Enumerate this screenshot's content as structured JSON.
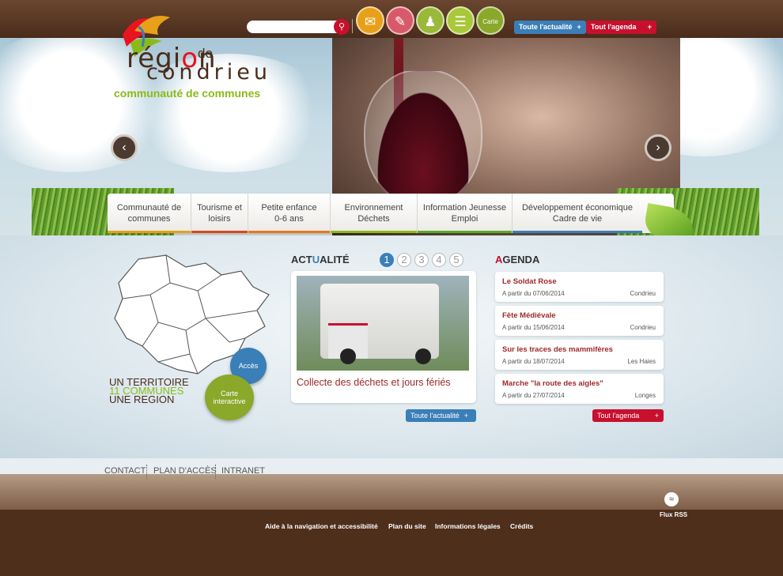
{
  "header": {
    "logo": {
      "line1_a": "régi",
      "line1_o": "o",
      "line1_b": "n",
      "line_de": "de",
      "line2": "condrieu",
      "line3": "communauté de communes"
    },
    "search": {
      "placeholder": ""
    },
    "quick_icons": [
      {
        "name": "envelope-icon",
        "color": "#e8a01a"
      },
      {
        "name": "newsletter-icon",
        "color": "#d85a6a"
      },
      {
        "name": "people-icon",
        "color": "#9ab83a"
      },
      {
        "name": "document-icon",
        "color": "#a8c83a"
      },
      {
        "name": "map-icon",
        "label": "Carte",
        "color": "#8aa82a"
      }
    ],
    "buttons": {
      "news": "Toute l'actualité",
      "agenda": "Tout l'agenda",
      "plus": "+"
    }
  },
  "carousel": {
    "prev": "‹",
    "next": "›"
  },
  "menu": [
    {
      "line1": "Communauté de",
      "line2": "communes",
      "color": "#e8a01a"
    },
    {
      "line1": "Tourisme et",
      "line2": "loisirs",
      "color": "#d8481a"
    },
    {
      "line1": "Petite enfance",
      "line2": "0-6 ans",
      "color": "#e8781a"
    },
    {
      "line1": "Environnement",
      "line2": "Déchets",
      "color": "#8aba1a"
    },
    {
      "line1": "Information Jeunesse",
      "line2": "Emploi",
      "color": "#5aaa2a"
    },
    {
      "line1": "Développement économique",
      "line2": "Cadre de vie",
      "color": "#3a7fb8"
    }
  ],
  "territory": {
    "line1": "UN TERRITOIRE",
    "line2": "11 COMMUNES",
    "line3": "UNE REGION",
    "acces": "Accès",
    "carte1": "Carte",
    "carte2": "interactive"
  },
  "news": {
    "title_a": "ACT",
    "title_u": "U",
    "title_b": "ALITÉ",
    "pages": [
      "1",
      "2",
      "3",
      "4",
      "5"
    ],
    "active_page": "1",
    "item_title": "Collecte des déchets et jours fériés",
    "button": "Toute l'actualité"
  },
  "agenda": {
    "title_a": "A",
    "title_b": "GENDA",
    "items": [
      {
        "title": "Le Soldat Rose",
        "date": "A partir du 07/06/2014",
        "place": "Condrieu"
      },
      {
        "title": "Fête Médiévale",
        "date": "A partir du 15/06/2014",
        "place": "Condrieu"
      },
      {
        "title": "Sur les traces des mammifères",
        "date": "A partir du 18/07/2014",
        "place": "Les Haies"
      },
      {
        "title": "Marche \"la route des aigles\"",
        "date": "A partir du 27/07/2014",
        "place": "Longes"
      }
    ],
    "button": "Tout l'agenda"
  },
  "footer": {
    "links": [
      "CONTACT",
      "PLAN D'ACCÈS",
      "INTRANET"
    ],
    "bottom_links": [
      "Aide à la navigation et accessibilité",
      "Plan du site",
      "Informations légales",
      "Crédits"
    ],
    "rss": "Flux RSS"
  },
  "colors": {
    "brown": "#4e2f1c",
    "blue": "#3a7fb8",
    "red": "#c8102e",
    "green": "#8aba1a"
  }
}
